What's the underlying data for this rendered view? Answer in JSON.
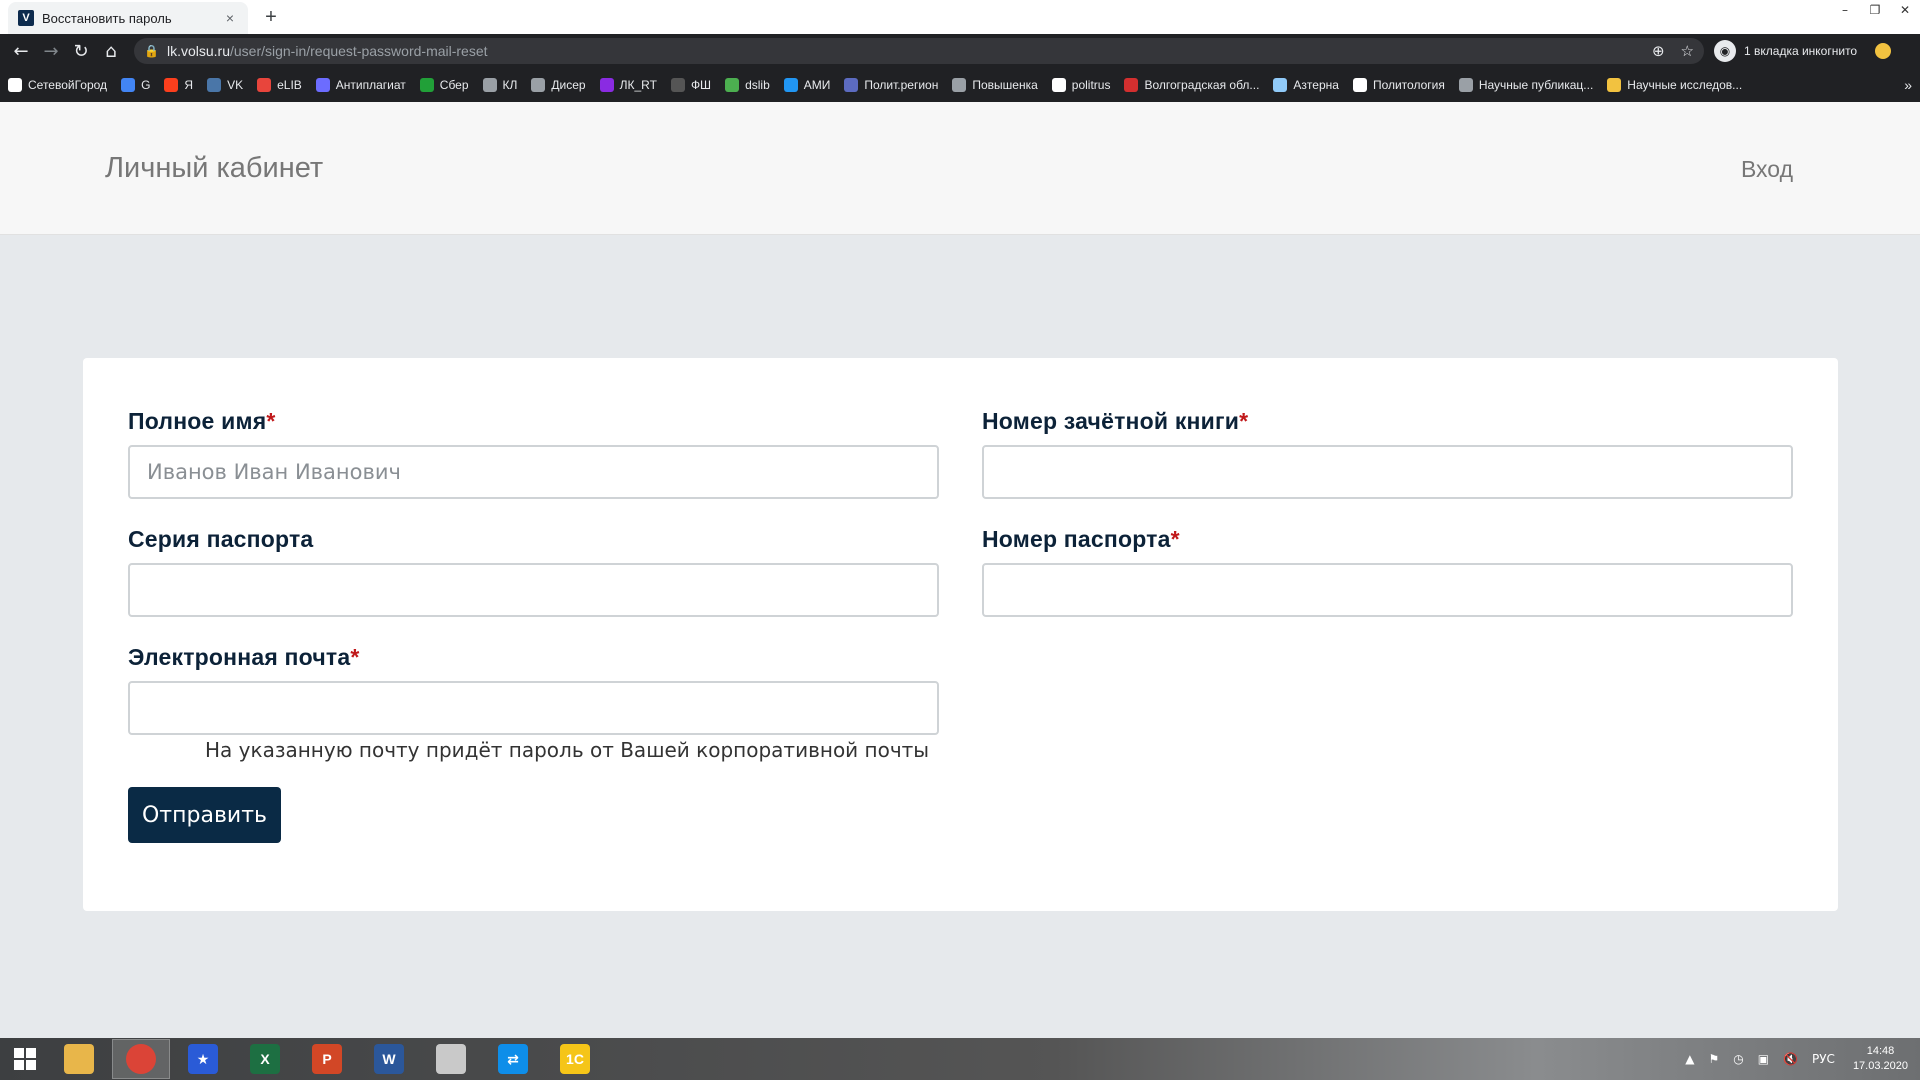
{
  "browser": {
    "tab_title": "Восстановить пароль",
    "tab_close": "×",
    "new_tab": "+",
    "url_host": "lk.volsu.ru",
    "url_path": "/user/sign-in/request-password-mail-reset",
    "incognito_label": "1 вкладка инкогнито",
    "bookmarks": [
      {
        "label": "СетевойГород",
        "color": "#ffffff"
      },
      {
        "label": "G",
        "color": "#4285f4"
      },
      {
        "label": "Я",
        "color": "#fc3f1d"
      },
      {
        "label": "VK",
        "color": "#4a76a8"
      },
      {
        "label": "eLIB",
        "color": "#e8453c"
      },
      {
        "label": "Антиплагиат",
        "color": "#6c6cff"
      },
      {
        "label": "Сбер",
        "color": "#21a038"
      },
      {
        "label": "КЛ",
        "color": "#9aa0a6"
      },
      {
        "label": "Дисер",
        "color": "#9aa0a6"
      },
      {
        "label": "ЛК_RT",
        "color": "#8a2be2"
      },
      {
        "label": "ФШ",
        "color": "#555555"
      },
      {
        "label": "dslib",
        "color": "#4caf50"
      },
      {
        "label": "АМИ",
        "color": "#2196f3"
      },
      {
        "label": "Полит.регион",
        "color": "#5c6bc0"
      },
      {
        "label": "Повышенка",
        "color": "#9aa0a6"
      },
      {
        "label": "politrus",
        "color": "#ffffff"
      },
      {
        "label": "Волгоградская обл...",
        "color": "#d32f2f"
      },
      {
        "label": "Азтерна",
        "color": "#90caf9"
      },
      {
        "label": "Политология",
        "color": "#ffffff"
      },
      {
        "label": "Научные публикац...",
        "color": "#9aa0a6"
      },
      {
        "label": "Научные исследов...",
        "color": "#f2c240"
      }
    ],
    "bookmarks_more": "»"
  },
  "site": {
    "brand": "Личный кабинет",
    "login": "Вход"
  },
  "form": {
    "full_name": {
      "label": "Полное имя",
      "required": "*",
      "placeholder": "Иванов Иван Иванович",
      "value": ""
    },
    "record_book": {
      "label": "Номер зачётной книги",
      "required": "*",
      "value": ""
    },
    "passport_series": {
      "label": "Серия паспорта",
      "value": ""
    },
    "passport_number": {
      "label": "Номер паспорта",
      "required": "*",
      "value": ""
    },
    "email": {
      "label": "Электронная почта",
      "required": "*",
      "value": ""
    },
    "email_hint": "На указанную почту придёт пароль от Вашей корпоративной почты",
    "submit_label": "Отправить"
  },
  "taskbar": {
    "apps": [
      {
        "name": "file-explorer",
        "label": "",
        "color": "#e8b64a"
      },
      {
        "name": "chrome",
        "label": "",
        "color": "#db4437"
      },
      {
        "name": "star-app",
        "label": "★",
        "color": "#2a5bd7"
      },
      {
        "name": "excel",
        "label": "X",
        "color": "#1d6f42"
      },
      {
        "name": "powerpoint",
        "label": "P",
        "color": "#d24726"
      },
      {
        "name": "word",
        "label": "W",
        "color": "#2b579a"
      },
      {
        "name": "paint-app",
        "label": "",
        "color": "#c9c9c9"
      },
      {
        "name": "teamviewer",
        "label": "⇄",
        "color": "#0e8ee9"
      },
      {
        "name": "1c",
        "label": "1C",
        "color": "#f5c518"
      }
    ],
    "language": "РУС",
    "time": "14:48",
    "date": "17.03.2020"
  }
}
